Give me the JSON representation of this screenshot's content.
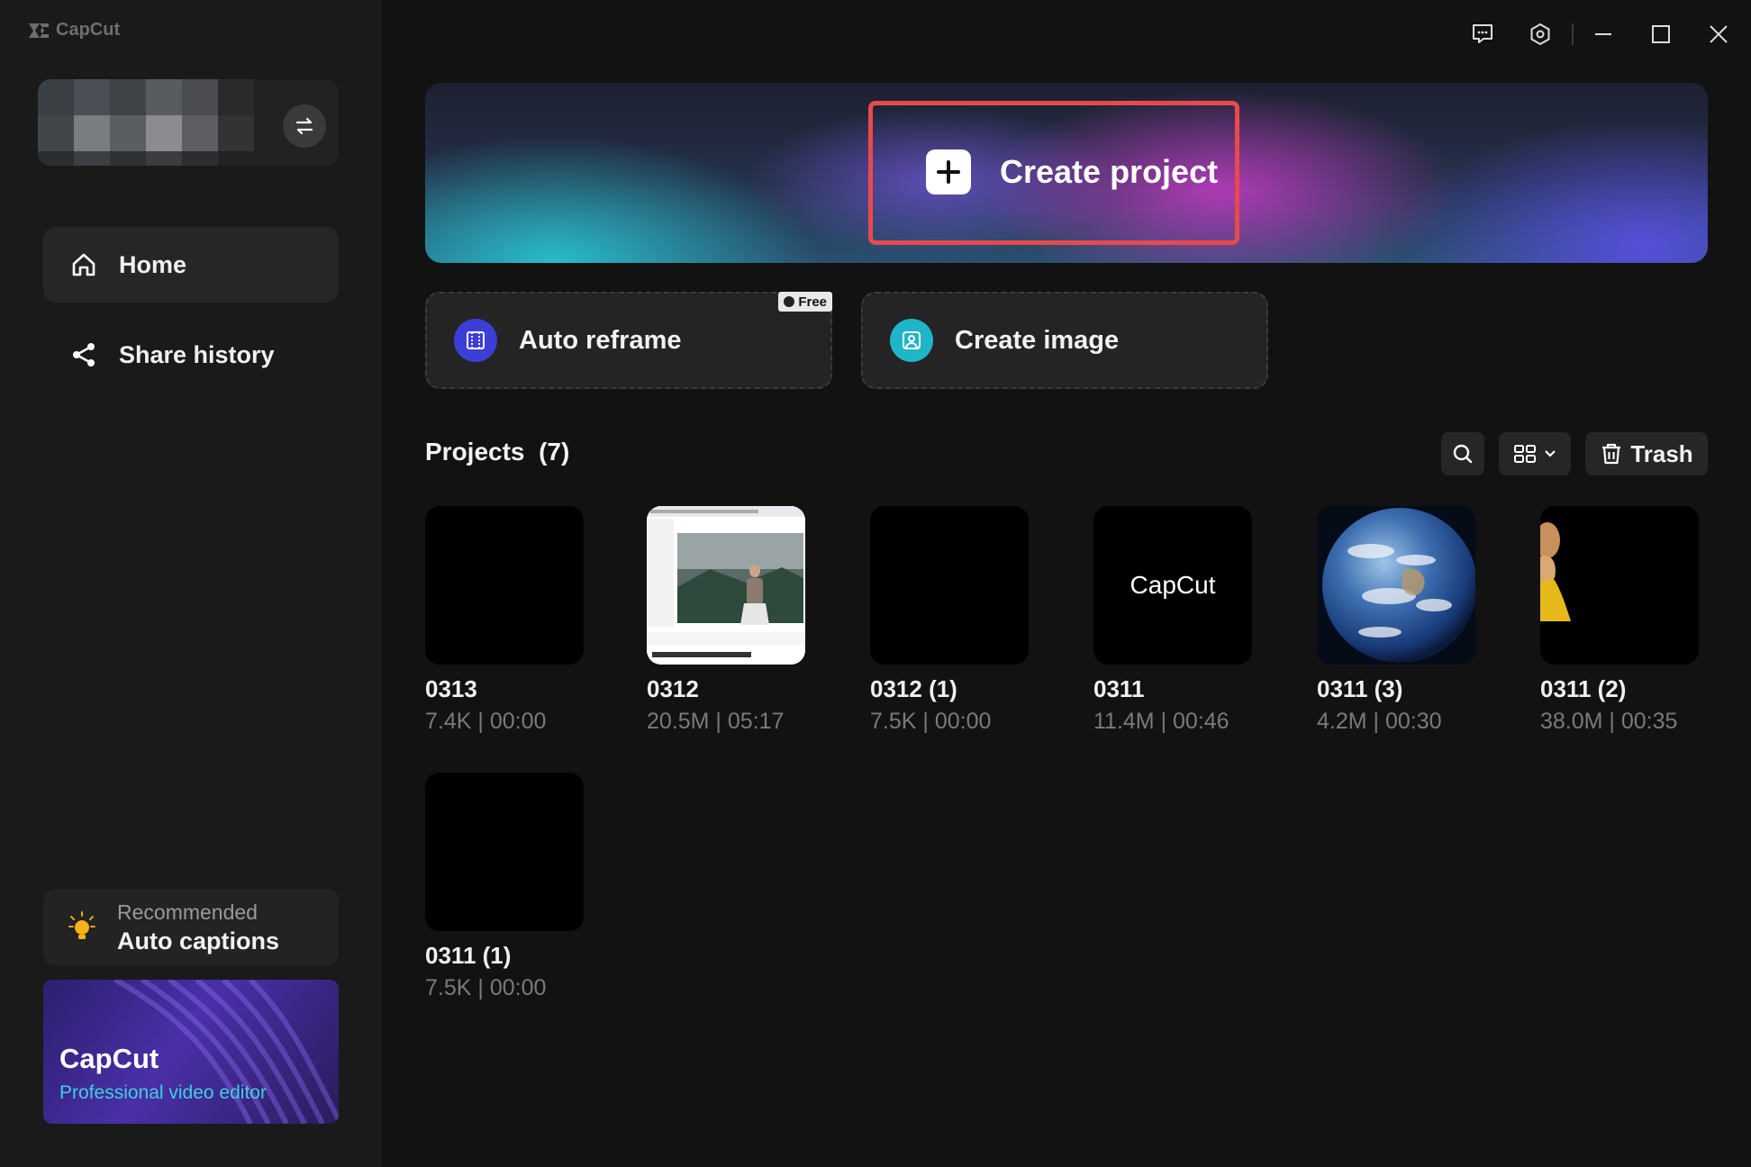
{
  "app": {
    "logo_text": "CapCut"
  },
  "sidebar": {
    "nav": [
      {
        "label": "Home",
        "icon": "home-icon",
        "active": true
      },
      {
        "label": "Share history",
        "icon": "share-icon",
        "active": false
      }
    ],
    "recommend": {
      "small": "Recommended",
      "title": "Auto captions"
    },
    "promo": {
      "title": "CapCut",
      "subtitle": "Professional video editor"
    }
  },
  "hero": {
    "create_label": "Create project"
  },
  "tools": [
    {
      "label": "Auto reframe",
      "badge": "Free",
      "color": "#3b3fd8"
    },
    {
      "label": "Create image",
      "color": "#1fb5c8"
    }
  ],
  "projects": {
    "title": "Projects",
    "count": "(7)",
    "trash_label": "Trash",
    "items": [
      {
        "name": "0313",
        "meta": "7.4K | 00:00",
        "thumb": "black"
      },
      {
        "name": "0312",
        "meta": "20.5M | 05:17",
        "thumb": "screenshot"
      },
      {
        "name": "0312 (1)",
        "meta": "7.5K | 00:00",
        "thumb": "black"
      },
      {
        "name": "0311",
        "meta": "11.4M | 00:46",
        "thumb": "capcut",
        "thumb_text": "CapCut"
      },
      {
        "name": "0311 (3)",
        "meta": "4.2M | 00:30",
        "thumb": "earth"
      },
      {
        "name": "0311 (2)",
        "meta": "38.0M | 00:35",
        "thumb": "person"
      },
      {
        "name": "0311 (1)",
        "meta": "7.5K | 00:00",
        "thumb": "black"
      }
    ]
  },
  "colors": {
    "accent_red": "#e84a4a",
    "bg": "#121212",
    "sidebar": "#1a1a1a"
  }
}
